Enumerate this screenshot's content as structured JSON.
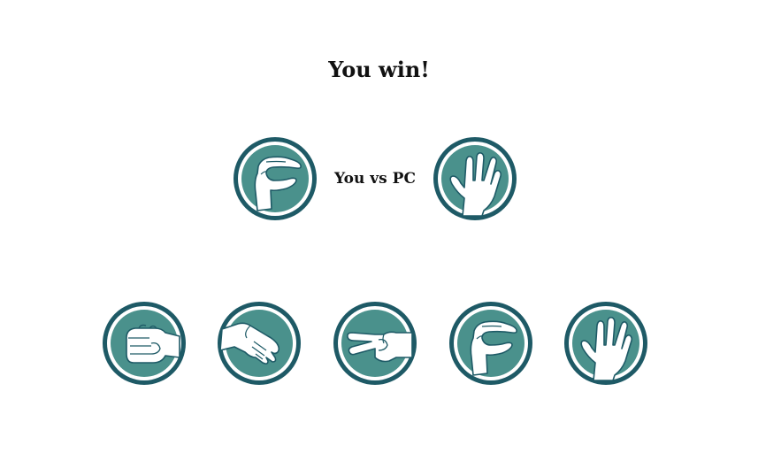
{
  "game": {
    "result_text": "You win!",
    "matchup_label": "You vs PC",
    "player_choice": {
      "name": "lizard",
      "icon": "lizard-hand-icon"
    },
    "pc_choice": {
      "name": "spock",
      "icon": "spock-hand-icon"
    },
    "choices": [
      {
        "name": "rock",
        "icon": "rock-fist-icon"
      },
      {
        "name": "paper",
        "icon": "paper-hand-icon"
      },
      {
        "name": "scissors",
        "icon": "scissors-hand-icon"
      },
      {
        "name": "lizard",
        "icon": "lizard-hand-icon"
      },
      {
        "name": "spock",
        "icon": "spock-hand-icon"
      }
    ]
  },
  "colors": {
    "ring": "#1e5a66",
    "fill": "#4a918c",
    "hand": "#ffffff",
    "text": "#111111"
  }
}
